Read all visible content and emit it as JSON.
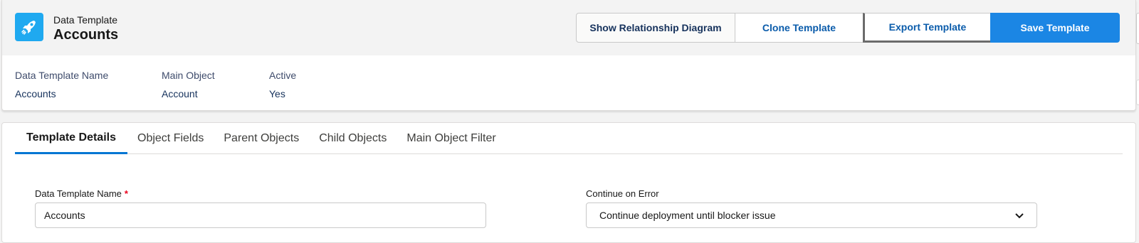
{
  "header": {
    "object_type": "Data Template",
    "record_name": "Accounts",
    "icon": "rocket-icon",
    "actions": {
      "show_diagram": "Show Relationship Diagram",
      "clone": "Clone Template",
      "export": "Export Template",
      "save": "Save Template"
    },
    "highlights": [
      {
        "label": "Data Template Name",
        "value": "Accounts"
      },
      {
        "label": "Main Object",
        "value": "Account"
      },
      {
        "label": "Active",
        "value": "Yes"
      }
    ]
  },
  "tabs": [
    {
      "label": "Template Details",
      "active": true
    },
    {
      "label": "Object Fields",
      "active": false
    },
    {
      "label": "Parent Objects",
      "active": false
    },
    {
      "label": "Child Objects",
      "active": false
    },
    {
      "label": "Main Object Filter",
      "active": false
    }
  ],
  "form": {
    "name_label": "Data Template Name",
    "name_required_mark": "*",
    "name_value": "Accounts",
    "continue_label": "Continue on Error",
    "continue_value": "Continue deployment until blocker issue"
  },
  "colors": {
    "brand": "#1b86e4",
    "icon_bg": "#1fa9f0",
    "tab_active": "#0176d3",
    "required": "#ea001e"
  }
}
